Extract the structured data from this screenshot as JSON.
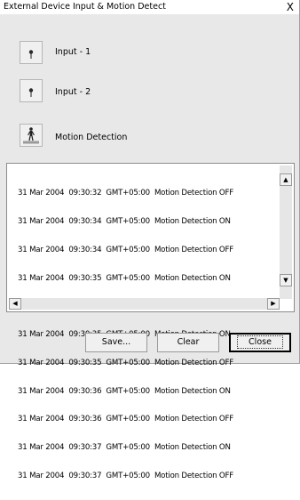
{
  "window": {
    "title": "External Device Input & Motion Detect",
    "close_glyph": "X"
  },
  "controls": [
    {
      "label": "Input - 1",
      "icon": "sensor-icon"
    },
    {
      "label": "Input - 2",
      "icon": "sensor-icon"
    },
    {
      "label": "Motion Detection",
      "icon": "person-icon"
    }
  ],
  "log": {
    "entries": [
      "31 Mar 2004  09:30:32  GMT+05:00  Motion Detection OFF",
      "31 Mar 2004  09:30:34  GMT+05:00  Motion Detection ON",
      "31 Mar 2004  09:30:34  GMT+05:00  Motion Detection OFF",
      "31 Mar 2004  09:30:35  GMT+05:00  Motion Detection ON",
      "31 Mar 2004  09:30:35  GMT+05:00  Motion Detection OFF",
      "31 Mar 2004  09:30:35  GMT+05:00  Motion Detection ON",
      "31 Mar 2004  09:30:35  GMT+05:00  Motion Detection OFF",
      "31 Mar 2004  09:30:36  GMT+05:00  Motion Detection ON",
      "31 Mar 2004  09:30:36  GMT+05:00  Motion Detection OFF",
      "31 Mar 2004  09:30:37  GMT+05:00  Motion Detection ON",
      "31 Mar 2004  09:30:37  GMT+05:00  Motion Detection OFF"
    ]
  },
  "buttons": {
    "save_label": "Save...",
    "clear_label": "Clear",
    "close_label": "Close"
  }
}
